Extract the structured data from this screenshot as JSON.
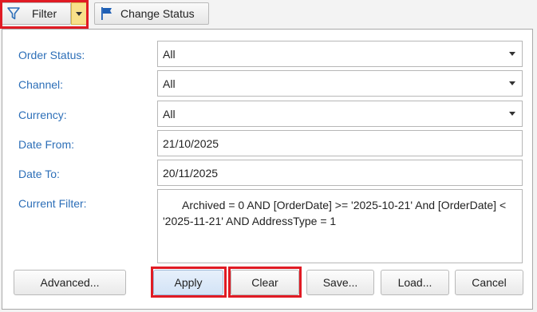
{
  "toolbar": {
    "filter_label": "Filter",
    "change_status_label": "Change Status"
  },
  "form": {
    "order_status": {
      "label": "Order Status:",
      "value": "All"
    },
    "channel": {
      "label": "Channel:",
      "value": "All"
    },
    "currency": {
      "label": "Currency:",
      "value": "All"
    },
    "date_from": {
      "label": "Date From:",
      "value": "21/10/2025"
    },
    "date_to": {
      "label": "Date To:",
      "value": "20/11/2025"
    },
    "current_filter": {
      "label": "Current Filter:",
      "value": "Archived = 0 AND [OrderDate] >= '2025-10-21' And [OrderDate] < '2025-11-21' AND AddressType = 1"
    }
  },
  "buttons": {
    "advanced": "Advanced...",
    "apply": "Apply",
    "clear": "Clear",
    "save": "Save...",
    "load": "Load...",
    "cancel": "Cancel"
  },
  "colors": {
    "label_blue": "#2d6fb8",
    "highlight_red": "#e01b24",
    "dropdown_yellow": "#f8e08a",
    "flag_blue": "#1f5fb5"
  }
}
